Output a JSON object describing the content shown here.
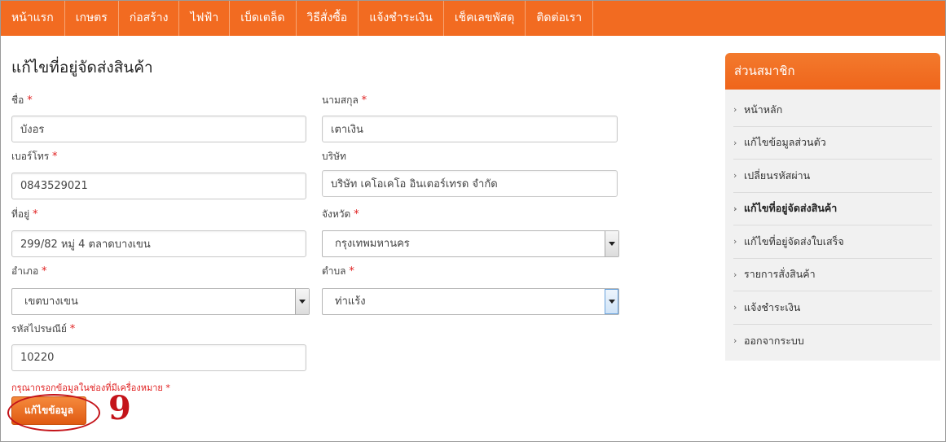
{
  "nav": {
    "items": [
      "หน้าแรก",
      "เกษตร",
      "ก่อสร้าง",
      "ไฟฟ้า",
      "เบ็ดเตล็ด",
      "วิธีสั่งซื้อ",
      "แจ้งชำระเงิน",
      "เช็คเลขพัสดุ",
      "ติดต่อเรา"
    ]
  },
  "page": {
    "title": "แก้ไขที่อยู่จัดส่งสินค้า"
  },
  "form": {
    "first_name": {
      "label": "ชื่อ",
      "required": "*",
      "value": "บังอร"
    },
    "last_name": {
      "label": "นามสกุล",
      "required": "*",
      "value": "เตาเงิน"
    },
    "phone": {
      "label": "เบอร์โทร",
      "required": "*",
      "value": "0843529021"
    },
    "company": {
      "label": "บริษัท",
      "value": "บริษัท เคโอเคโอ อินเตอร์เทรด จำกัด"
    },
    "address": {
      "label": "ที่อยู่",
      "required": "*",
      "value": "299/82 หมู่ 4 ตลาดบางเขน"
    },
    "province": {
      "label": "จังหวัด",
      "required": "*",
      "value": "กรุงเทพมหานคร"
    },
    "district": {
      "label": "อำเภอ",
      "required": "*",
      "value": "เขตบางเขน"
    },
    "subdistrict": {
      "label": "ตำบล",
      "required": "*",
      "value": "ท่าแร้ง"
    },
    "postcode": {
      "label": "รหัสไปรษณีย์",
      "required": "*",
      "value": "10220"
    },
    "note": "กรุณากรอกข้อมูลในช่องที่มีเครื่องหมาย *",
    "submit_label": "แก้ไขข้อมูล"
  },
  "annotation": {
    "number": "9",
    "color": "#c4141a"
  },
  "sidebar": {
    "title": "ส่วนสมาชิก",
    "items": [
      {
        "label": "หน้าหลัก"
      },
      {
        "label": "แก้ไขข้อมูลส่วนตัว"
      },
      {
        "label": "เปลี่ยนรหัสผ่าน"
      },
      {
        "label": "แก้ไขที่อยู่จัดส่งสินค้า"
      },
      {
        "label": "แก้ไขที่อยู่จัดส่งใบเสร็จ"
      },
      {
        "label": "รายการสั่งสินค้า"
      },
      {
        "label": "แจ้งชำระเงิน"
      },
      {
        "label": "ออกจากระบบ"
      }
    ]
  },
  "colors": {
    "brand": "#f26b21",
    "required": "#e02020"
  }
}
